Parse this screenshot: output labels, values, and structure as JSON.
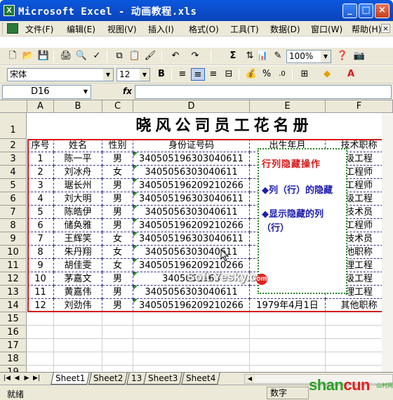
{
  "window": {
    "title": "Microsoft Excel - 动画教程.xls",
    "min": "_",
    "max": "□",
    "close": "×"
  },
  "menu": [
    "文件(F)",
    "编辑(E)",
    "视图(V)",
    "插入(I)",
    "格式(O)",
    "工具(T)",
    "数据(D)",
    "窗口(W)",
    "帮助(H)"
  ],
  "toolbar": {
    "zoom": "100%",
    "sigma": "Σ"
  },
  "format": {
    "font": "宋体",
    "size": "12",
    "bold": "B"
  },
  "formula_bar": {
    "name_box": "D16",
    "fx": "fx",
    "value": ""
  },
  "columns": [
    "A",
    "B",
    "C",
    "D",
    "E",
    "F"
  ],
  "rows": [
    "1",
    "2",
    "3",
    "4",
    "5",
    "6",
    "7",
    "8",
    "9",
    "10",
    "11",
    "12",
    "13",
    "14",
    "15",
    "16",
    "17",
    "18",
    "19"
  ],
  "sheet_title": "晓风公司员工花名册",
  "headers": [
    "序号",
    "姓名",
    "性别",
    "身份证号码",
    "出生年月",
    "技术职称"
  ],
  "table": [
    [
      "1",
      "陈一平",
      "男",
      "340505196303040611",
      "",
      "级工程"
    ],
    [
      "2",
      "刘冰舟",
      "女",
      "3405056303040611",
      "",
      "工程师"
    ],
    [
      "3",
      "琚长州",
      "男",
      "340505196209210266",
      "",
      "工程师"
    ],
    [
      "4",
      "刘大明",
      "男",
      "340505196303040611",
      "",
      "级工程"
    ],
    [
      "5",
      "陈皓伊",
      "男",
      "3405056303040611",
      "",
      "技术员"
    ],
    [
      "6",
      "储奂雅",
      "男",
      "340505196209210266",
      "",
      "工程师"
    ],
    [
      "7",
      "王辉笑",
      "女",
      "340505196303040611",
      "",
      "技术员"
    ],
    [
      "8",
      "朱丹翔",
      "女",
      "3405056303040611",
      "",
      "他职称"
    ],
    [
      "9",
      "胡佳雯",
      "女",
      "340505196209210266",
      "",
      "理工程"
    ],
    [
      "10",
      "茅嘉文",
      "男",
      "3405051963",
      "",
      "级工程"
    ],
    [
      "11",
      "黄嘉伟",
      "男",
      "3405056303040611",
      "",
      "理工程"
    ],
    [
      "12",
      "刘劲伟",
      "男",
      "340505196209210266",
      "1979年4月1日",
      "其他职称"
    ]
  ],
  "note": {
    "title": "行列隐藏操作",
    "items": [
      "◆列（行）的隐藏",
      "◆显示隐藏的列（行）"
    ]
  },
  "watermark": "Soft.Yesky.c",
  "watermark_circle": "om",
  "tabs": [
    "Sheet1",
    "Sheet2",
    "13",
    "Sheet3",
    "Sheet4"
  ],
  "status": {
    "ready": "就绪",
    "num": "数字"
  },
  "logo": {
    "text_a": "shan",
    "text_b": "cun",
    "suffix": ".net",
    "small": "山村网"
  }
}
